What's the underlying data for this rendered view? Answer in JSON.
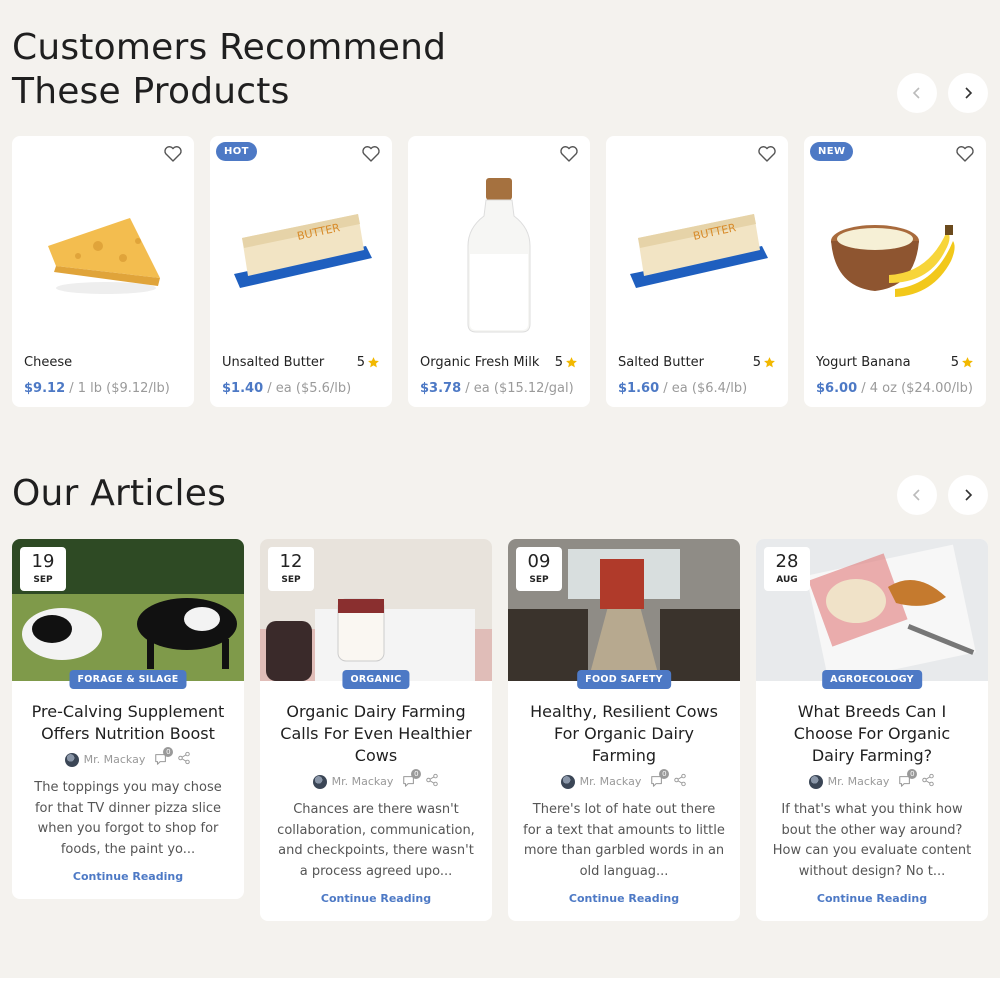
{
  "products_section": {
    "title": "Customers Recommend\nThese Products",
    "items": [
      {
        "name": "Cheese",
        "price": "$9.12",
        "unit": " / 1 lb ($9.12/lb)",
        "rating": "",
        "badge": "",
        "image": "cheese"
      },
      {
        "name": "Unsalted Butter",
        "price": "$1.40",
        "unit": " / ea ($5.6/lb)",
        "rating": "5",
        "badge": "HOT",
        "image": "butter"
      },
      {
        "name": "Organic Fresh Milk",
        "price": "$3.78",
        "unit": " / ea ($15.12/gal)",
        "rating": "5",
        "badge": "",
        "image": "milk"
      },
      {
        "name": "Salted Butter",
        "price": "$1.60",
        "unit": " / ea ($6.4/lb)",
        "rating": "5",
        "badge": "",
        "image": "butter"
      },
      {
        "name": "Yogurt Banana",
        "price": "$6.00",
        "unit": " / 4 oz ($24.00/lb)",
        "rating": "5",
        "badge": "NEW",
        "image": "yogurt"
      }
    ]
  },
  "articles_section": {
    "title": "Our Articles",
    "items": [
      {
        "day": "19",
        "month": "SEP",
        "tag": "FORAGE & SILAGE",
        "title": "Pre-Calving Supplement Offers Nutrition Boost",
        "author": "Mr. Mackay",
        "comments": "0",
        "excerpt": "The toppings you may chose for that TV dinner pizza slice when you forgot to shop for foods, the paint yo...",
        "link": "Continue Reading",
        "image": "cows"
      },
      {
        "day": "12",
        "month": "SEP",
        "tag": "ORGANIC",
        "title": "Organic Dairy Farming Calls For Even Healthier Cows",
        "author": "Mr. Mackay",
        "comments": "0",
        "excerpt": "Chances are there wasn't collaboration, communication, and checkpoints, there wasn't a process agreed upo...",
        "link": "Continue Reading",
        "image": "yogurt-jar"
      },
      {
        "day": "09",
        "month": "SEP",
        "tag": "FOOD SAFETY",
        "title": "Healthy, Resilient Cows For Organic Dairy Farming",
        "author": "Mr. Mackay",
        "comments": "0",
        "excerpt": "There's lot of hate out there for a text that amounts to little more than garbled words in an old languag...",
        "link": "Continue Reading",
        "image": "barn"
      },
      {
        "day": "28",
        "month": "AUG",
        "tag": "AGROECOLOGY",
        "title": "What Breeds Can I Choose For Organic Dairy Farming?",
        "author": "Mr. Mackay",
        "comments": "0",
        "excerpt": "If that's what you think how bout the other way around? How can you evaluate content without design? No t...",
        "link": "Continue Reading",
        "image": "bread"
      }
    ]
  },
  "colors": {
    "accent": "#4d79c5",
    "star": "#f2b800",
    "background": "#f4f2ee"
  }
}
